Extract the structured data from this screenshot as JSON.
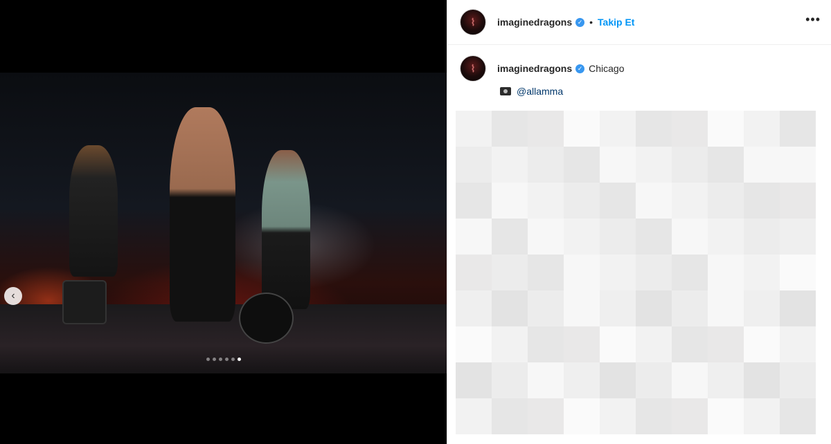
{
  "post": {
    "username": "imaginedragons",
    "follow_label": "Takip Et",
    "separator": "•",
    "more_label": "•••",
    "verified_glyph": "✓"
  },
  "caption": {
    "username": "imaginedragons",
    "location": "Chicago",
    "credit_mention": "@allamma"
  },
  "carousel": {
    "slides": 6,
    "active_index": 5,
    "prev_glyph": "‹"
  },
  "icons": {
    "verified": "verified-badge-icon",
    "more": "more-options-icon",
    "camera": "camera-icon",
    "prev": "chevron-left-icon"
  },
  "colors": {
    "follow": "#0095f6",
    "verified": "#3897f0",
    "mention": "#00376b"
  }
}
